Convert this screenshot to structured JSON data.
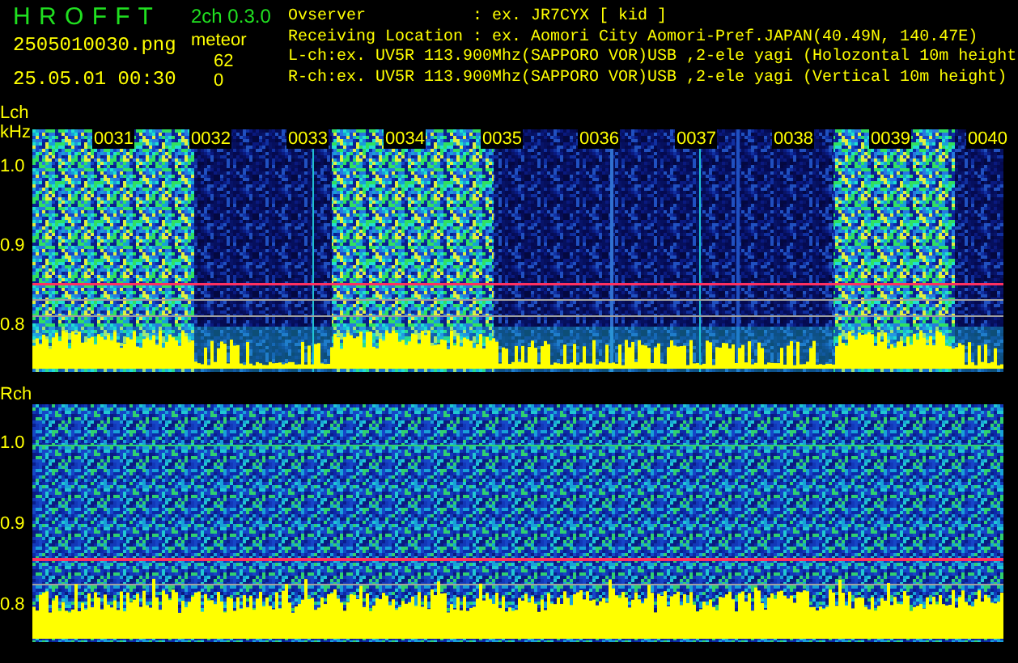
{
  "app": {
    "title": "H R O F F T",
    "version": "2ch 0.3.0",
    "file": "2505010030.png",
    "timestamp": "25.05.01 00:30",
    "meteor_label": "meteor",
    "counts": [
      "62",
      "0"
    ]
  },
  "info_lines": [
    "Ovserver           : ex. JR7CYX [ kid ]",
    "Receiving Location : ex. Aomori City Aomori-Pref.JAPAN(40.49N, 140.47E)",
    "L-ch:ex. UV5R 113.900Mhz(SAPPORO VOR)USB ,2-ele yagi (Holozontal 10m height",
    "R-ch:ex. UV5R 113.900Mhz(SAPPORO VOR)USB ,2-ele yagi (Vertical 10m height)"
  ],
  "panels": [
    {
      "channel": "Lch",
      "unit": "kHz",
      "minutes": [
        "0031",
        "0032",
        "0033",
        "0034",
        "0035",
        "0036",
        "0037",
        "0038",
        "0039",
        "0040"
      ],
      "yticks": [
        "1.0",
        "0.9",
        "0.8"
      ]
    },
    {
      "channel": "Rch",
      "yticks": [
        "1.0",
        "0.9",
        "0.8"
      ]
    }
  ]
}
